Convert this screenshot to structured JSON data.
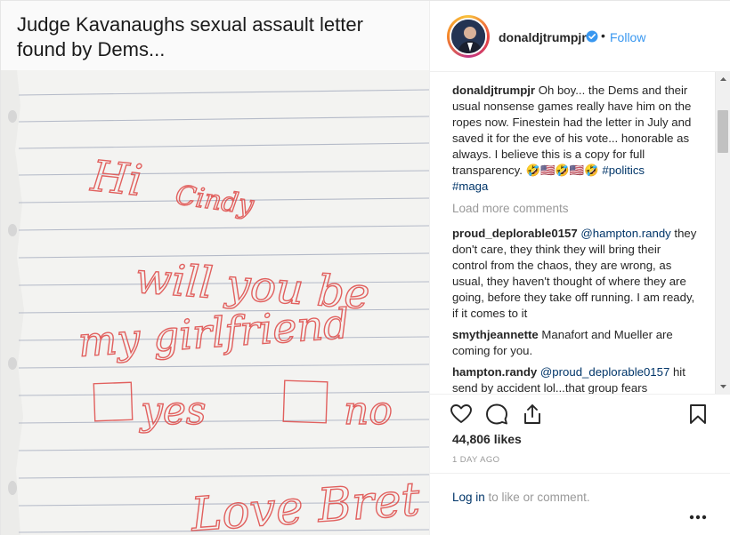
{
  "media": {
    "caption": "Judge Kavanaughs sexual assault letter found by Dems...",
    "note_lines": [
      "Hi Cindy",
      "will you be",
      "my girlfriend",
      "yes",
      "no",
      "Love Bret"
    ]
  },
  "header": {
    "username": "donaldjtrumpjr",
    "separator": "•",
    "follow_label": "Follow"
  },
  "caption": {
    "username": "donaldjtrumpjr",
    "text": " Oh boy... the Dems and their usual nonsense games really have him on the ropes now. Finestein had the letter in July and saved it for the eve of his vote... honorable as always. I believe this is a copy for full transparency. 🤣🇺🇸🤣🇺🇸🤣 ",
    "hashtags": [
      "#politics",
      "#maga"
    ]
  },
  "load_more": "Load more comments",
  "comments": [
    {
      "username": "proud_deplorable0157",
      "mention": "@hampton.randy",
      "text": " they don't care, they think they will bring their control from the chaos, they are wrong, as usual, they haven't thought of where they are going, before they take off running. I am ready, if it comes to it"
    },
    {
      "username": "smythjeannette",
      "mention": "",
      "text": " Manafort and Mueller are coming for you."
    },
    {
      "username": "hampton.randy",
      "mention": "@proud_deplorable0157",
      "text": " hit send by accident lol...that group fears"
    }
  ],
  "likes": "44,806 likes",
  "time_ago": "1 DAY AGO",
  "login": {
    "link": "Log in",
    "text": " to like or comment."
  },
  "colors": {
    "link_blue": "#3897f0",
    "hashtag": "#003569",
    "muted": "#999999",
    "ink_red": "#e0514f"
  },
  "icons": [
    "verified-badge-icon",
    "heart-icon",
    "comment-icon",
    "share-icon",
    "bookmark-icon",
    "more-options-icon",
    "scroll-up-arrow-icon",
    "scroll-down-arrow-icon"
  ]
}
